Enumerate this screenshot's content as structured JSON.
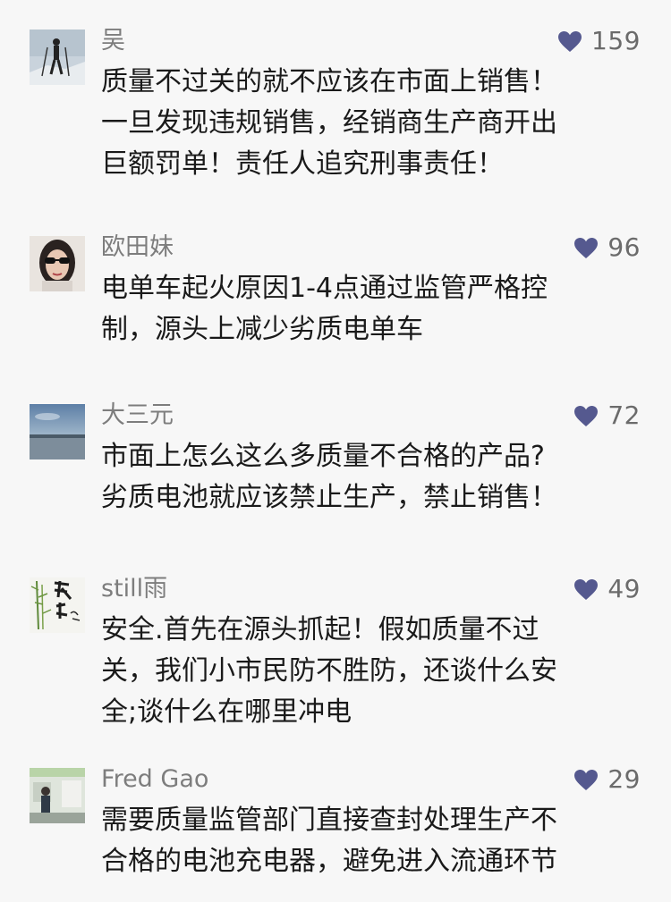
{
  "like_icon": "heart-icon",
  "like_color": "#55598f",
  "comments": [
    {
      "name": "吴",
      "likes": "159",
      "lines": [
        "质量不过关的就不应该在市面上销售！",
        "一旦发现违规销售，经销商生产商开出",
        "巨额罚单！责任人追究刑事责任！"
      ]
    },
    {
      "name": "欧田妹",
      "likes": "96",
      "lines": [
        "电单车起火原因1-4点通过监管严格控",
        "制，源头上减少劣质电单车"
      ]
    },
    {
      "name": "大三元",
      "likes": "72",
      "lines": [
        "市面上怎么这么多质量不合格的产品?",
        "劣质电池就应该禁止生产，禁止销售！"
      ]
    },
    {
      "name": "still雨",
      "likes": "49",
      "lines": [
        "安全.首先在源头抓起！假如质量不过",
        "关，我们小市民防不胜防，还谈什么安",
        "全;谈什么在哪里冲电"
      ]
    },
    {
      "name": "Fred Gao",
      "likes": "29",
      "lines": [
        "需要质量监管部门直接查封处理生产不",
        "合格的电池充电器，避免进入流通环节"
      ]
    }
  ]
}
